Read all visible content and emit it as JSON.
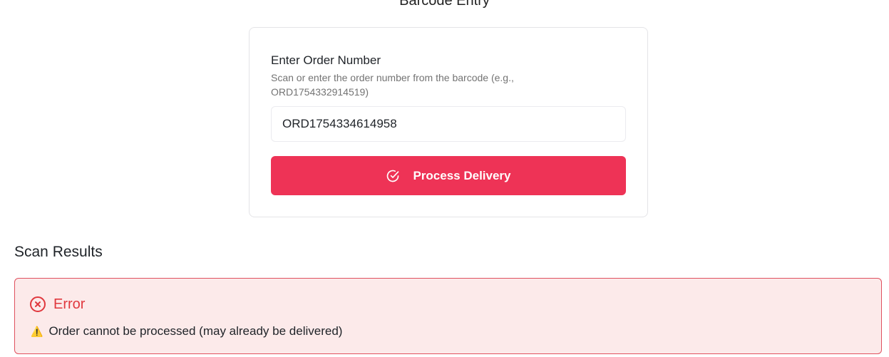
{
  "page": {
    "title": "Barcode Entry"
  },
  "entry_card": {
    "label": "Enter Order Number",
    "help_text": "Scan or enter the order number from the barcode (e.g., ORD1754332914519)",
    "input_value": "ORD1754334614958",
    "button_label": "Process Delivery",
    "button_icon": "check-circle-icon"
  },
  "results": {
    "section_title": "Scan Results",
    "error_title": "Error",
    "error_icon": "x-circle-icon",
    "warning_icon": "warning-triangle-icon",
    "warning_glyph": "⚠️",
    "message": "Order cannot be processed (may already be delivered)"
  },
  "colors": {
    "accent": "#ee3356",
    "error_text": "#e0383e",
    "error_border": "#e0515f",
    "error_background": "#fceaea"
  }
}
